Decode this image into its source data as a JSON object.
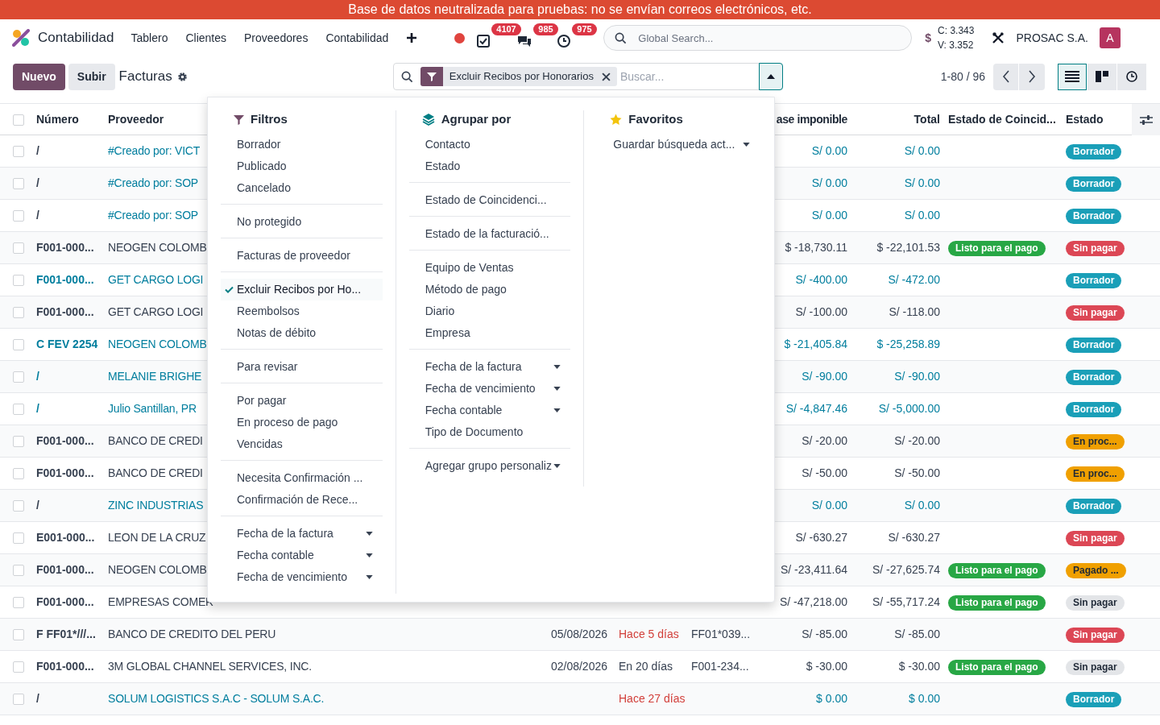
{
  "banner": {
    "text": "Base de datos neutralizada para pruebas: no se envían correos electrónicos, etc."
  },
  "navbar": {
    "app_name": "Contabilidad",
    "menu": [
      "Tablero",
      "Clientes",
      "Proveedores",
      "Contabilidad"
    ],
    "indicators": [
      {
        "kind": "tasks",
        "count": "4107"
      },
      {
        "kind": "chat",
        "count": "985"
      },
      {
        "kind": "activity",
        "count": "975"
      }
    ],
    "global_search": {
      "placeholder": "Global Search..."
    },
    "currency": {
      "symbol": "$",
      "buy": "C: 3.343",
      "sell": "V: 3.352"
    },
    "company": "PROSAC S.A.",
    "avatar": "A"
  },
  "control_panel": {
    "buttons": [
      "Nuevo",
      "Subir"
    ],
    "title": "Facturas",
    "search": {
      "facet": "Excluir Recibos por Honorarios",
      "placeholder": "Buscar...",
      "expanded": true
    },
    "pager": "1-80 / 96",
    "views": [
      {
        "kind": "list",
        "selected": true
      },
      {
        "kind": "kanban",
        "selected": false
      },
      {
        "kind": "activity",
        "selected": false
      }
    ]
  },
  "search_panel": {
    "filters": {
      "title": "Filtros",
      "groups": [
        [
          {
            "label": "Borrador",
            "selected": false
          },
          {
            "label": "Publicado",
            "selected": false
          },
          {
            "label": "Cancelado",
            "selected": false
          }
        ],
        [
          {
            "label": "No protegido",
            "selected": false
          }
        ],
        [
          {
            "label": "Facturas de proveedor",
            "selected": false
          }
        ],
        [
          {
            "label": "Excluir Recibos por Ho...",
            "selected": true
          },
          {
            "label": "Reembolsos",
            "selected": false
          },
          {
            "label": "Notas de débito",
            "selected": false
          }
        ],
        [
          {
            "label": "Para revisar",
            "selected": false
          }
        ],
        [
          {
            "label": "Por pagar",
            "selected": false
          },
          {
            "label": "En proceso de pago",
            "selected": false
          },
          {
            "label": "Vencidas",
            "selected": false
          }
        ],
        [
          {
            "label": "Necesita Confirmación ...",
            "selected": false
          },
          {
            "label": "Confirmación de Rece...",
            "selected": false
          }
        ],
        [
          {
            "label": "Fecha de la factura",
            "selected": false,
            "has_options": true
          },
          {
            "label": "Fecha contable",
            "selected": false,
            "has_options": true
          },
          {
            "label": "Fecha de vencimiento",
            "selected": false,
            "has_options": true
          }
        ]
      ]
    },
    "group_by": {
      "title": "Agrupar por",
      "groups": [
        [
          {
            "label": "Contacto"
          },
          {
            "label": "Estado"
          }
        ],
        [
          {
            "label": "Estado de Coincidenci..."
          }
        ],
        [
          {
            "label": "Estado de la facturació..."
          }
        ],
        [
          {
            "label": "Equipo de Ventas"
          },
          {
            "label": "Método de pago"
          },
          {
            "label": "Diario"
          },
          {
            "label": "Empresa"
          }
        ],
        [
          {
            "label": "Fecha de la factura",
            "has_options": true
          },
          {
            "label": "Fecha de vencimiento",
            "has_options": true
          },
          {
            "label": "Fecha contable",
            "has_options": true
          },
          {
            "label": "Tipo de Documento"
          }
        ],
        [
          {
            "label": "Agregar grupo personaliz",
            "has_options": true
          }
        ]
      ]
    },
    "favorites": {
      "title": "Favoritos",
      "items": [
        {
          "label": "Guardar búsqueda act...",
          "has_options": true
        }
      ]
    }
  },
  "table": {
    "all_checked": false,
    "columns": [
      "Número",
      "Proveedor",
      "ase imponible",
      "Total",
      "Estado de Coincid...",
      "Estado"
    ],
    "rows": [
      {
        "checked": false,
        "number": "/",
        "provider": "#Creado por: VICT",
        "draft": true,
        "number_highlighted": false,
        "base": "S/ 0.00",
        "total": "S/ 0.00",
        "status": {
          "label": "Borrador",
          "kind": "draft"
        }
      },
      {
        "checked": false,
        "number": "/",
        "provider": "#Creado por: SOP",
        "draft": true,
        "number_highlighted": false,
        "base": "S/ 0.00",
        "total": "S/ 0.00",
        "status": {
          "label": "Borrador",
          "kind": "draft"
        }
      },
      {
        "checked": false,
        "number": "/",
        "provider": "#Creado por: SOP",
        "draft": true,
        "number_highlighted": false,
        "base": "S/ 0.00",
        "total": "S/ 0.00",
        "status": {
          "label": "Borrador",
          "kind": "draft"
        }
      },
      {
        "checked": false,
        "number": "F001-000...",
        "provider": "NEOGEN COLOMB",
        "draft": false,
        "number_highlighted": false,
        "base": "$ -18,730.11",
        "total": "$ -22,101.53",
        "match": "Listo para el pago",
        "status": {
          "label": "Sin pagar",
          "kind": "unpaid"
        }
      },
      {
        "checked": false,
        "number": "F001-000...",
        "provider": "GET CARGO LOGI",
        "draft": true,
        "number_highlighted": true,
        "base": "S/ -400.00",
        "total": "S/ -472.00",
        "status": {
          "label": "Borrador",
          "kind": "draft"
        }
      },
      {
        "checked": false,
        "number": "F001-000...",
        "provider": "GET CARGO LOGI",
        "draft": false,
        "number_highlighted": false,
        "base": "S/ -100.00",
        "total": "S/ -118.00",
        "status": {
          "label": "Sin pagar",
          "kind": "unpaid"
        }
      },
      {
        "checked": false,
        "number": "C FEV 2254",
        "provider": "NEOGEN COLOMB",
        "draft": true,
        "number_highlighted": true,
        "base": "$ -21,405.84",
        "total": "$ -25,258.89",
        "status": {
          "label": "Borrador",
          "kind": "draft"
        }
      },
      {
        "checked": false,
        "number": "/",
        "provider": "MELANIE BRIGHE",
        "draft": true,
        "number_highlighted": true,
        "base": "S/ -90.00",
        "total": "S/ -90.00",
        "status": {
          "label": "Borrador",
          "kind": "draft"
        }
      },
      {
        "checked": false,
        "number": "/",
        "provider": "Julio Santillan, PR",
        "draft": true,
        "number_highlighted": true,
        "base": "S/ -4,847.46",
        "total": "S/ -5,000.00",
        "status": {
          "label": "Borrador",
          "kind": "draft"
        }
      },
      {
        "checked": false,
        "number": "F001-000...",
        "provider": "BANCO DE CREDI",
        "draft": false,
        "number_highlighted": false,
        "base": "S/ -20.00",
        "total": "S/ -20.00",
        "status": {
          "label": "En proc...",
          "kind": "in_process"
        }
      },
      {
        "checked": false,
        "number": "F001-000...",
        "provider": "BANCO DE CREDI",
        "draft": false,
        "number_highlighted": false,
        "base": "S/ -50.00",
        "total": "S/ -50.00",
        "status": {
          "label": "En proc...",
          "kind": "in_process"
        }
      },
      {
        "checked": false,
        "number": "/",
        "provider": "ZINC INDUSTRIAS",
        "draft": true,
        "number_highlighted": false,
        "base": "S/ 0.00",
        "total": "S/ 0.00",
        "status": {
          "label": "Borrador",
          "kind": "draft"
        }
      },
      {
        "checked": false,
        "number": "E001-000...",
        "provider": "LEON DE LA CRUZ",
        "draft": false,
        "number_highlighted": false,
        "base": "S/ -630.27",
        "total": "S/ -630.27",
        "status": {
          "label": "Sin pagar",
          "kind": "unpaid"
        }
      },
      {
        "checked": false,
        "number": "F001-000...",
        "provider": "NEOGEN COLOMB",
        "draft": false,
        "number_highlighted": false,
        "base": "S/ -23,411.64",
        "total": "S/ -27,625.74",
        "match": "Listo para el pago",
        "status": {
          "label": "Pagado ...",
          "kind": "paid"
        }
      },
      {
        "checked": false,
        "number": "F001-000...",
        "provider": "EMPRESAS COMER",
        "draft": false,
        "number_highlighted": false,
        "base": "S/ -47,218.00",
        "total": "S/ -55,717.24",
        "match": "Listo para el pago",
        "status": {
          "label": "Sin pagar",
          "kind": "unpaid_muted"
        }
      },
      {
        "checked": false,
        "number": "F FF01*///...",
        "provider": "BANCO DE CREDITO DEL PERU",
        "draft": false,
        "number_highlighted": false,
        "date": "05/08/2026",
        "due": "Hace 5 días",
        "overdue": true,
        "reference": "FF01*039...",
        "base": "S/ -85.00",
        "total": "S/ -85.00",
        "status": {
          "label": "Sin pagar",
          "kind": "unpaid"
        }
      },
      {
        "checked": false,
        "number": "F001-000...",
        "provider": "3M GLOBAL CHANNEL SERVICES, INC.",
        "draft": false,
        "number_highlighted": false,
        "date": "02/08/2026",
        "due": "En 20 días",
        "overdue": false,
        "reference": "F001-234...",
        "base": "$ -30.00",
        "total": "$ -30.00",
        "match": "Listo para el pago",
        "status": {
          "label": "Sin pagar",
          "kind": "unpaid_muted"
        }
      },
      {
        "checked": false,
        "number": "/",
        "provider": "SOLUM LOGISTICS S.A.C - SOLUM S.A.C.",
        "draft": true,
        "number_highlighted": false,
        "due": "Hace 27 días",
        "overdue": true,
        "base": "$ 0.00",
        "total": "$ 0.00",
        "status": {
          "label": "Borrador",
          "kind": "draft"
        }
      }
    ]
  }
}
